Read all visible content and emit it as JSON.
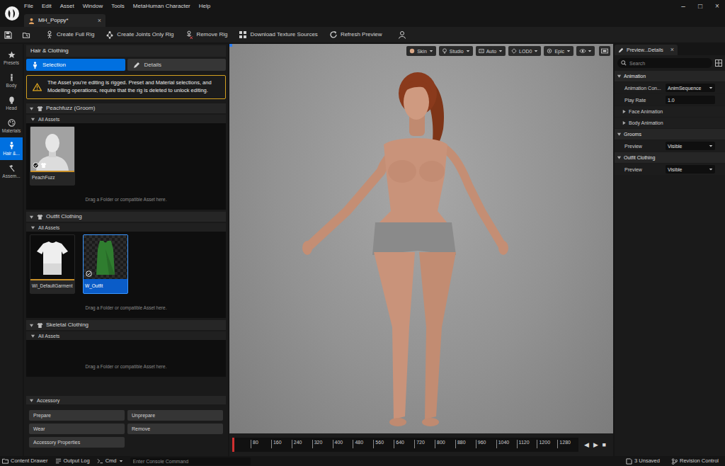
{
  "window": {
    "menu": [
      "File",
      "Edit",
      "Asset",
      "Window",
      "Tools",
      "MetaHuman Character",
      "Help"
    ],
    "controls": [
      "–",
      "□",
      "×"
    ]
  },
  "document_tabs": [
    {
      "label": "MH_Poppy*",
      "selected": true,
      "close": "×"
    }
  ],
  "toolbar": {
    "buttons": [
      "Create Full Rig",
      "Create Joints Only Rig",
      "Remove Rig",
      "Download Texture Sources",
      "Refresh Preview"
    ]
  },
  "sidebar": {
    "items": [
      {
        "label": "Presets",
        "selected": false
      },
      {
        "label": "Body",
        "selected": false
      },
      {
        "label": "Head",
        "selected": false
      },
      {
        "label": "Materials",
        "selected": false
      },
      {
        "label": "Hair &...",
        "selected": true
      },
      {
        "label": "Assem...",
        "selected": false
      }
    ]
  },
  "panel": {
    "title": "Hair & Clothing",
    "tabs": [
      {
        "label": "Selection",
        "selected": true
      },
      {
        "label": "Details",
        "selected": false
      }
    ],
    "warning": "The Asset you're editing is rigged. Preset and Material selections, and Modelling operations, require that the rig is deleted to unlock editing.",
    "sections": [
      {
        "title": "Peachfuzz (Groom)",
        "expanded": true,
        "subheader": "All Assets",
        "subheader_expanded": true,
        "drop_hint": "Drag a Folder or compatible Asset here.",
        "assets": [
          {
            "label": "PeachFuzz",
            "kind": "groom",
            "selected": false,
            "applied": true,
            "wardrobe": true
          }
        ]
      },
      {
        "title": "Outfit Clothing",
        "expanded": true,
        "subheader": "All Assets",
        "subheader_expanded": true,
        "drop_hint": "Drag a Folder or compatible Asset here.",
        "assets": [
          {
            "label": "WI_DefaultGarment",
            "kind": "garment",
            "selected": false,
            "applied": false,
            "wardrobe": false
          },
          {
            "label": "W_Outfit",
            "kind": "outfit",
            "selected": true,
            "applied": true,
            "wardrobe": false
          }
        ]
      },
      {
        "title": "Skeletal Clothing",
        "expanded": true,
        "subheader": "All Assets",
        "subheader_expanded": true,
        "drop_hint": "Drag a Folder or compatible Asset here.",
        "assets": []
      }
    ],
    "accessory": {
      "title": "Accessory",
      "expanded": true,
      "buttons": [
        "Prepare",
        "Unprepare",
        "Wear",
        "Remove",
        "Accessory Properties"
      ]
    }
  },
  "viewport": {
    "toolbar": [
      {
        "label": "Skin"
      },
      {
        "label": "Studio"
      },
      {
        "label": "Auto"
      },
      {
        "label": "LOD0"
      },
      {
        "label": "Epic"
      }
    ],
    "timeline": {
      "playhead": {
        "level": 0
      },
      "ticks": [
        "80",
        "160",
        "240",
        "320",
        "400",
        "480",
        "560",
        "640",
        "720",
        "800",
        "880",
        "960",
        "1040",
        "1120",
        "1200",
        "1280"
      ],
      "controls": [
        "◀",
        "▶",
        "■"
      ]
    }
  },
  "details": {
    "tab": "Preview...Details",
    "close": "×",
    "search": {
      "placeholder": "Search"
    },
    "sections": [
      {
        "title": "Animation",
        "kind": "category",
        "expanded": true,
        "rows": [
          {
            "label": "Animation Con...",
            "value": "AnimSequence",
            "kind": "dropdown"
          },
          {
            "label": "Play Rate",
            "value": "1.0",
            "kind": "number"
          }
        ]
      },
      {
        "title": "Face Animation",
        "kind": "subcategory",
        "expanded": false,
        "rows": []
      },
      {
        "title": "Body Animation",
        "kind": "subcategory",
        "expanded": false,
        "rows": []
      },
      {
        "title": "Grooms",
        "kind": "category",
        "expanded": true,
        "rows": [
          {
            "label": "Preview",
            "value": "Visible",
            "kind": "dropdown"
          }
        ]
      },
      {
        "title": "Outfit Clothing",
        "kind": "category",
        "expanded": true,
        "rows": [
          {
            "label": "Preview",
            "value": "Visible",
            "kind": "dropdown"
          }
        ]
      }
    ]
  },
  "status_bar": {
    "left": [
      "Content Drawer",
      "Output Log",
      "Cmd"
    ],
    "console": {
      "placeholder": "Enter Console Command"
    },
    "right": [
      "3 Unsaved",
      "Revision Control"
    ]
  }
}
